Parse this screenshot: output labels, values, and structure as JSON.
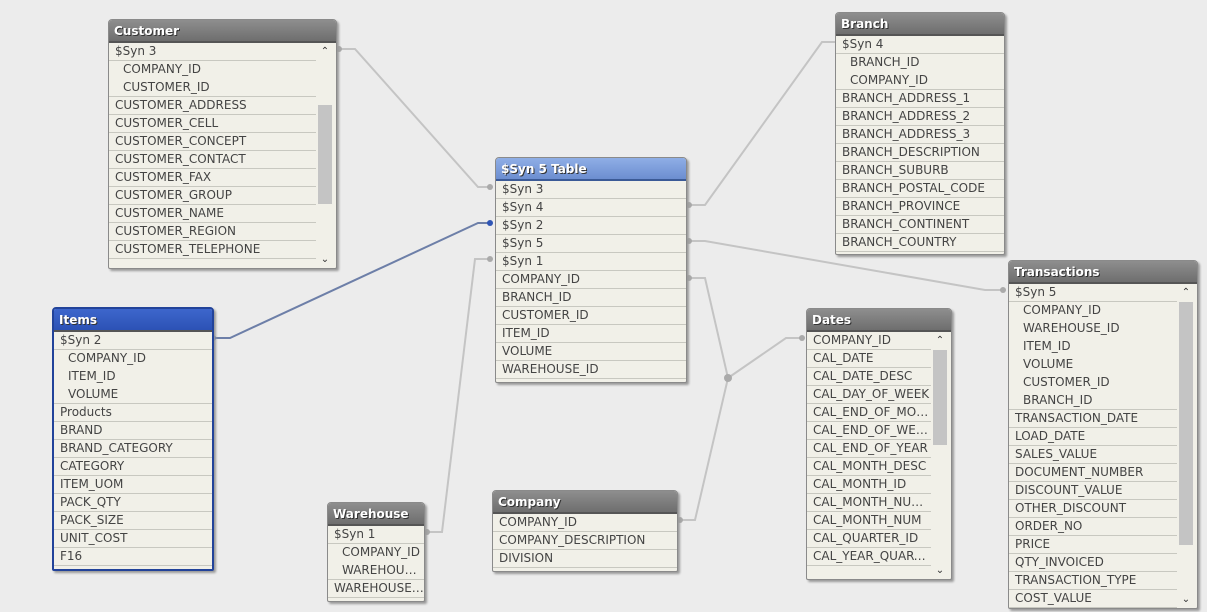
{
  "tables": [
    {
      "id": "customer",
      "title": "Customer",
      "style": "grey",
      "scroll": true,
      "fields": [
        {
          "n": "$Syn 3"
        },
        {
          "n": "COMPANY_ID",
          "i": 1
        },
        {
          "n": "CUSTOMER_ID",
          "i": 1,
          "l": 1
        },
        {
          "n": "CUSTOMER_ADDRESS"
        },
        {
          "n": "CUSTOMER_CELL"
        },
        {
          "n": "CUSTOMER_CONCEPT"
        },
        {
          "n": "CUSTOMER_CONTACT"
        },
        {
          "n": "CUSTOMER_FAX"
        },
        {
          "n": "CUSTOMER_GROUP"
        },
        {
          "n": "CUSTOMER_NAME"
        },
        {
          "n": "CUSTOMER_REGION"
        },
        {
          "n": "CUSTOMER_TELEPHONE"
        }
      ]
    },
    {
      "id": "branch",
      "title": "Branch",
      "style": "grey",
      "fields": [
        {
          "n": "$Syn 4"
        },
        {
          "n": "BRANCH_ID",
          "i": 1
        },
        {
          "n": "COMPANY_ID",
          "i": 1,
          "l": 1
        },
        {
          "n": "BRANCH_ADDRESS_1"
        },
        {
          "n": "BRANCH_ADDRESS_2"
        },
        {
          "n": "BRANCH_ADDRESS_3"
        },
        {
          "n": "BRANCH_DESCRIPTION"
        },
        {
          "n": "BRANCH_SUBURB"
        },
        {
          "n": "BRANCH_POSTAL_CODE"
        },
        {
          "n": "BRANCH_PROVINCE"
        },
        {
          "n": "BRANCH_CONTINENT"
        },
        {
          "n": "BRANCH_COUNTRY"
        }
      ]
    },
    {
      "id": "syn5",
      "title": "$Syn 5 Table",
      "style": "blue",
      "fields": [
        {
          "n": "$Syn 3"
        },
        {
          "n": "$Syn 4"
        },
        {
          "n": "$Syn 2"
        },
        {
          "n": "$Syn 5"
        },
        {
          "n": "$Syn 1"
        },
        {
          "n": "COMPANY_ID"
        },
        {
          "n": "BRANCH_ID"
        },
        {
          "n": "CUSTOMER_ID"
        },
        {
          "n": "ITEM_ID"
        },
        {
          "n": "VOLUME"
        },
        {
          "n": "WAREHOUSE_ID"
        }
      ]
    },
    {
      "id": "items",
      "title": "Items",
      "style": "selected",
      "fields": [
        {
          "n": "$Syn 2"
        },
        {
          "n": "COMPANY_ID",
          "i": 1
        },
        {
          "n": "ITEM_ID",
          "i": 1
        },
        {
          "n": "VOLUME",
          "i": 1,
          "l": 1
        },
        {
          "n": "Products"
        },
        {
          "n": "BRAND"
        },
        {
          "n": "BRAND_CATEGORY"
        },
        {
          "n": "CATEGORY"
        },
        {
          "n": "ITEM_UOM"
        },
        {
          "n": "PACK_QTY"
        },
        {
          "n": "PACK_SIZE"
        },
        {
          "n": "UNIT_COST"
        },
        {
          "n": "F16"
        }
      ]
    },
    {
      "id": "warehouse",
      "title": "Warehouse",
      "style": "grey",
      "fields": [
        {
          "n": "$Syn 1"
        },
        {
          "n": "COMPANY_ID",
          "i": 1
        },
        {
          "n": "WAREHOUSE_ID",
          "i": 1,
          "l": 1
        },
        {
          "n": "WAREHOUSE_DESCRIPTION"
        }
      ]
    },
    {
      "id": "company",
      "title": "Company",
      "style": "grey",
      "fields": [
        {
          "n": "COMPANY_ID"
        },
        {
          "n": "COMPANY_DESCRIPTION"
        },
        {
          "n": "DIVISION"
        }
      ]
    },
    {
      "id": "dates",
      "title": "Dates",
      "style": "grey",
      "scroll": true,
      "fields": [
        {
          "n": "COMPANY_ID"
        },
        {
          "n": "CAL_DATE"
        },
        {
          "n": "CAL_DATE_DESC"
        },
        {
          "n": "CAL_DAY_OF_WEEK"
        },
        {
          "n": "CAL_END_OF_MONTH"
        },
        {
          "n": "CAL_END_OF_WEEK"
        },
        {
          "n": "CAL_END_OF_YEAR"
        },
        {
          "n": "CAL_MONTH_DESC"
        },
        {
          "n": "CAL_MONTH_ID"
        },
        {
          "n": "CAL_MONTH_NUMBER"
        },
        {
          "n": "CAL_MONTH_NUM"
        },
        {
          "n": "CAL_QUARTER_ID"
        },
        {
          "n": "CAL_YEAR_QUARTER"
        }
      ]
    },
    {
      "id": "transactions",
      "title": "Transactions",
      "style": "grey",
      "scroll": true,
      "fields": [
        {
          "n": "$Syn 5"
        },
        {
          "n": "COMPANY_ID",
          "i": 1
        },
        {
          "n": "WAREHOUSE_ID",
          "i": 1
        },
        {
          "n": "ITEM_ID",
          "i": 1
        },
        {
          "n": "VOLUME",
          "i": 1
        },
        {
          "n": "CUSTOMER_ID",
          "i": 1
        },
        {
          "n": "BRANCH_ID",
          "i": 1,
          "l": 1
        },
        {
          "n": "TRANSACTION_DATE"
        },
        {
          "n": "LOAD_DATE"
        },
        {
          "n": "SALES_VALUE"
        },
        {
          "n": "DOCUMENT_NUMBER"
        },
        {
          "n": "DISCOUNT_VALUE"
        },
        {
          "n": "OTHER_DISCOUNT"
        },
        {
          "n": "ORDER_NO"
        },
        {
          "n": "PRICE"
        },
        {
          "n": "QTY_INVOICED"
        },
        {
          "n": "TRANSACTION_TYPE"
        },
        {
          "n": "COST_VALUE"
        }
      ]
    }
  ]
}
